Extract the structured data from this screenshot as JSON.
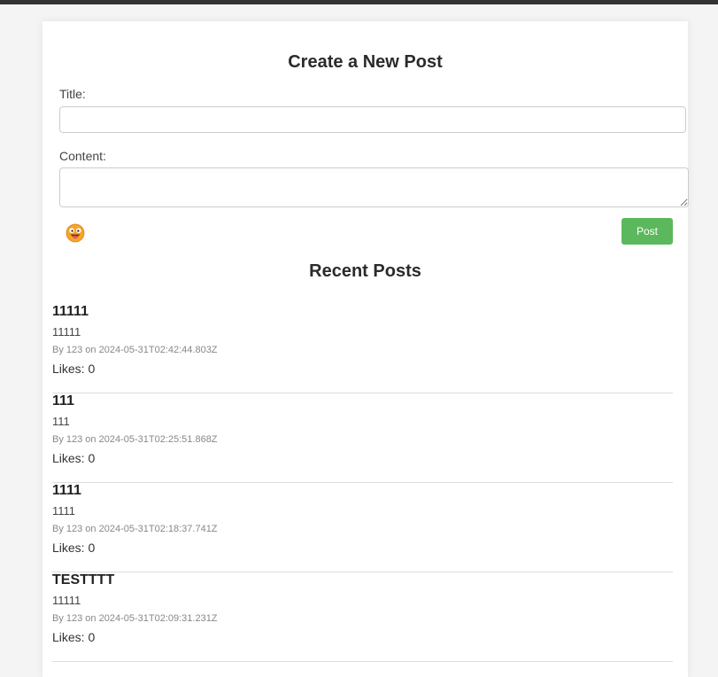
{
  "colors": {
    "top_bar": "#333333",
    "page_background": "#f4f4f4",
    "card_background": "#ffffff",
    "post_button": "#5cb85c",
    "divider": "#dddddd"
  },
  "create_form": {
    "heading": "Create a New Post",
    "title_label": "Title:",
    "title_value": "",
    "title_placeholder": "",
    "content_label": "Content:",
    "content_value": "",
    "content_placeholder": "",
    "emoji_icon": "emoji-smiley-tongue-icon",
    "post_button_label": "Post"
  },
  "recent": {
    "heading": "Recent Posts",
    "posts": [
      {
        "title": "11111",
        "content": "11111",
        "meta": "By 123 on 2024-05-31T02:42:44.803Z",
        "likes": "Likes: 0"
      },
      {
        "title": "111",
        "content": "111",
        "meta": "By 123 on 2024-05-31T02:25:51.868Z",
        "likes": "Likes: 0"
      },
      {
        "title": "1111",
        "content": "1111",
        "meta": "By 123 on 2024-05-31T02:18:37.741Z",
        "likes": "Likes: 0"
      },
      {
        "title": "TESTTTT",
        "content": "11111",
        "meta": "By 123 on 2024-05-31T02:09:31.231Z",
        "likes": "Likes: 0"
      }
    ]
  }
}
